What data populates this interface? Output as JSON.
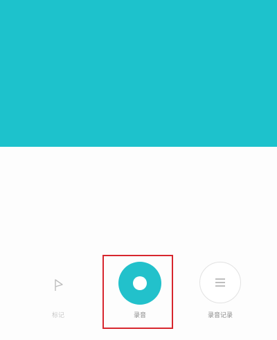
{
  "colors": {
    "accent": "#1dc2cc",
    "highlight": "#d7262e"
  },
  "icons": {
    "mark": "flag-outline-icon",
    "record": "record-circle-icon",
    "records": "list-lines-icon"
  },
  "controls": {
    "mark_label": "标记",
    "record_label": "录音",
    "records_label": "录音记录"
  }
}
